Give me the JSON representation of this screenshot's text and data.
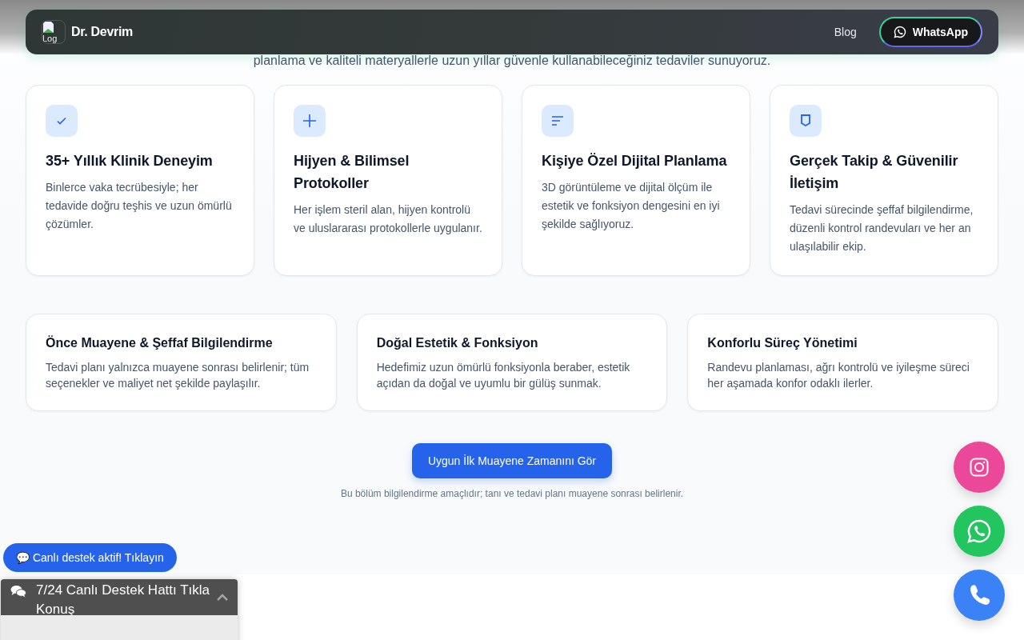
{
  "header": {
    "logo_alt": "Log",
    "brand": "Dr. Devrim",
    "nav": [
      {
        "label": "Blog"
      }
    ],
    "cta": {
      "label": "WhatsApp"
    }
  },
  "intro": {
    "subtitle": "planlama ve kaliteli materyallerle uzun yıllar güvenle kullanabileceğiniz tedaviler sunuyoruz."
  },
  "features": [
    {
      "kind": "check",
      "title": "35+ Yıllık Klinik Deneyim",
      "text": "Binlerce vaka tecrübesiyle; her tedavide doğru teşhis ve uzun ömürlü çözümler."
    },
    {
      "kind": "plus",
      "title": "Hijyen & Bilimsel Protokoller",
      "text": "Her işlem steril alan, hijyen kontrolü ve uluslararası protokollerle uygulanır."
    },
    {
      "kind": "lines",
      "title": "Kişiye Özel Dijital Planlama",
      "text": "3D görüntüleme ve dijital ölçüm ile estetik ve fonksiyon dengesini en iyi şekilde sağlıyoruz."
    },
    {
      "kind": "shield",
      "title": "Gerçek Takip & Güvenilir İletişim",
      "text": "Tedavi sürecinde şeffaf bilgilendirme, düzenli kontrol randevuları ve her an ulaşılabilir ekip."
    }
  ],
  "highlights": [
    {
      "title": "Önce Muayene & Şeffaf Bilgilendirme",
      "text": "Tedavi planı yalnızca muayene sonrası belirlenir; tüm seçenekler ve maliyet net şekilde paylaşılır."
    },
    {
      "title": "Doğal Estetik & Fonksiyon",
      "text": "Hedefimiz uzun ömürlü fonksiyonla beraber, estetik açıdan da doğal ve uyumlu bir gülüş sunmak."
    },
    {
      "title": "Konforlu Süreç Yönetimi",
      "text": "Randevu planlaması, ağrı kontrolü ve iyileşme süreci her aşamada konfor odaklı ilerler."
    }
  ],
  "cta": {
    "label": "Uygun İlk Muayene Zamanını Gör",
    "note": "Bu bölüm bilgilendirme amaçlıdır; tanı ve tedavi planı muayene sonrası belirlenir."
  },
  "live_chat_pill": {
    "label": "💬 Canlı destek aktif! Tıklayın"
  },
  "chat_widget": {
    "title": "7/24 Canlı Destek Hattı Tıkla Konuş",
    "expanded": false
  },
  "floating_buttons": [
    {
      "kind": "instagram",
      "color": "#ec4899"
    },
    {
      "kind": "whatsapp",
      "color": "#22c55e"
    },
    {
      "kind": "phone",
      "color": "#3b82f6"
    }
  ]
}
